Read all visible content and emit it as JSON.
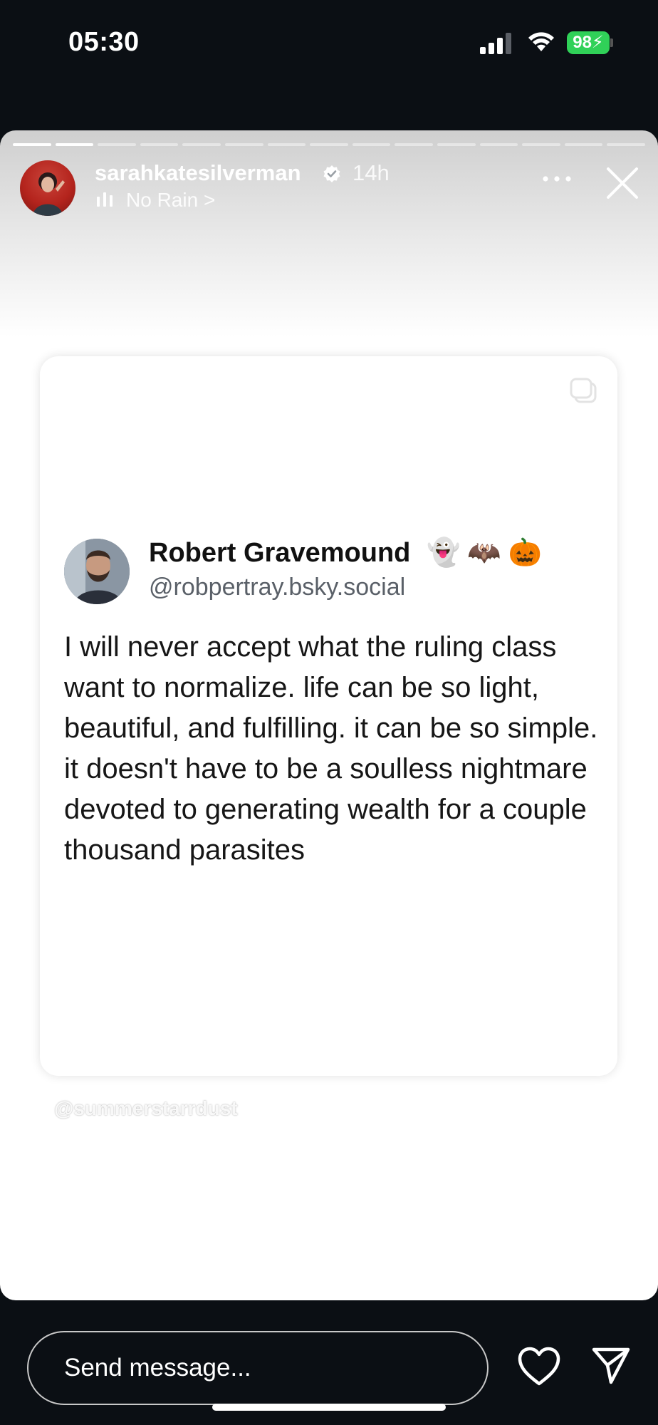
{
  "status_bar": {
    "time": "05:30",
    "battery": "98",
    "icons": [
      "cellular-signal-icon",
      "wifi-icon",
      "battery-charging-icon"
    ],
    "battery_color": "#30d158"
  },
  "story": {
    "progress": {
      "segments": 15,
      "current": 2
    },
    "author": {
      "username": "sarahkatesilverman",
      "verified": true,
      "time_ago": "14h"
    },
    "music": {
      "label": "No Rain >",
      "icon": "music-bars-icon"
    },
    "post": {
      "name": "Robert Gravemound",
      "emojis": [
        "👻",
        "🦇",
        "🎃"
      ],
      "handle": "@robpertray.bsky.social",
      "text": "I will never accept what the ruling class want to normalize. life can be so light, beautiful, and fulfilling. it can be so simple. it doesn't have to be a soulless nightmare devoted to generating wealth for a couple thousand parasites"
    },
    "watermark": "@summerstarrdust"
  },
  "bottom_bar": {
    "message_placeholder": "Send message...",
    "icons": [
      "heart-icon",
      "send-icon"
    ]
  }
}
